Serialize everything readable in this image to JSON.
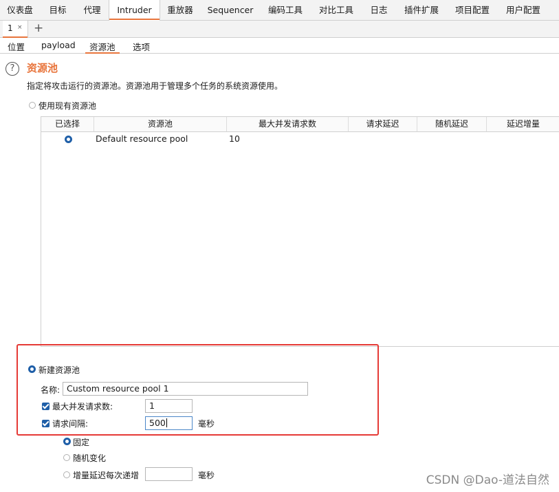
{
  "top_tabs": [
    "仪表盘",
    "目标",
    "代理",
    "Intruder",
    "重放器",
    "Sequencer",
    "编码工具",
    "对比工具",
    "日志",
    "插件扩展",
    "项目配置",
    "用户配置"
  ],
  "instance_tab": {
    "label": "1",
    "close": "×",
    "add": "+"
  },
  "sub_tabs": [
    "位置",
    "payload",
    "资源池",
    "选项"
  ],
  "section": {
    "title": "资源池",
    "description": "指定将攻击运行的资源池。资源池用于管理多个任务的系统资源使用。",
    "help_icon": "?"
  },
  "use_existing_label": "使用现有资源池",
  "table": {
    "headers": [
      "已选择",
      "资源池",
      "最大并发请求数",
      "请求延迟",
      "随机延迟",
      "延迟增量"
    ],
    "rows": [
      {
        "selected": true,
        "name": "Default resource pool",
        "max_concurrent": "10",
        "delay": "",
        "random_delay": "",
        "delay_increment": ""
      }
    ]
  },
  "new_pool": {
    "label": "新建资源池",
    "name_label": "名称:",
    "name_value": "Custom resource pool 1",
    "max_concurrent_label": "最大并发请求数:",
    "max_concurrent_value": "1",
    "max_concurrent_checked": true,
    "interval_label": "请求间隔:",
    "interval_value": "500",
    "interval_checked": true,
    "interval_unit": "毫秒"
  },
  "delay_modes": {
    "fixed": "固定",
    "random": "随机变化",
    "incremental": "增量延迟每次递增",
    "incremental_unit": "毫秒",
    "selected": "fixed"
  },
  "watermark": "CSDN @Dao-道法自然",
  "colors": {
    "accent": "#e8743b",
    "selected": "#1f5fa8",
    "highlight": "#e53935"
  }
}
